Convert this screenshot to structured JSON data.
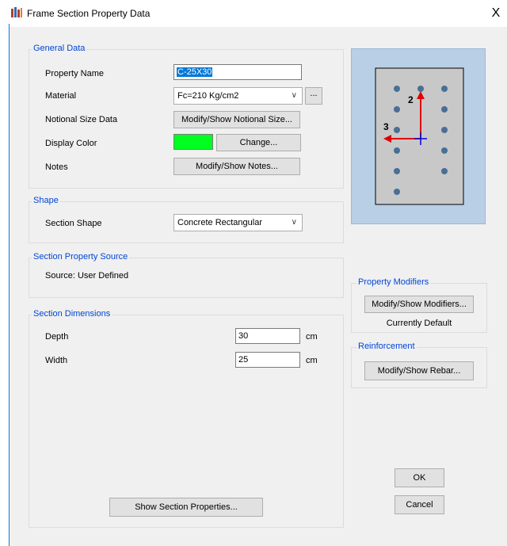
{
  "window": {
    "title": "Frame Section Property Data",
    "close_glyph": "X"
  },
  "general": {
    "legend": "General Data",
    "property_name_label": "Property Name",
    "property_name_value": "C-25X30",
    "material_label": "Material",
    "material_value": "Fc=210 Kg/cm2",
    "material_more": "...",
    "notional_label": "Notional Size Data",
    "notional_button": "Modify/Show Notional Size...",
    "color_label": "Display Color",
    "color_value": "#00ff21",
    "color_button": "Change...",
    "notes_label": "Notes",
    "notes_button": "Modify/Show Notes..."
  },
  "shape": {
    "legend": "Shape",
    "section_shape_label": "Section Shape",
    "section_shape_value": "Concrete Rectangular"
  },
  "source": {
    "legend": "Section Property Source",
    "text": "Source:  User Defined"
  },
  "dimensions": {
    "legend": "Section Dimensions",
    "depth_label": "Depth",
    "depth_value": "30",
    "depth_unit": "cm",
    "width_label": "Width",
    "width_value": "25",
    "width_unit": "cm",
    "show_props_button": "Show Section Properties..."
  },
  "preview": {
    "axis2_label": "2",
    "axis3_label": "3",
    "bar_count": 12
  },
  "modifiers": {
    "legend": "Property Modifiers",
    "button": "Modify/Show Modifiers...",
    "status": "Currently Default"
  },
  "reinforcement": {
    "legend": "Reinforcement",
    "button": "Modify/Show Rebar..."
  },
  "actions": {
    "ok": "OK",
    "cancel": "Cancel"
  }
}
